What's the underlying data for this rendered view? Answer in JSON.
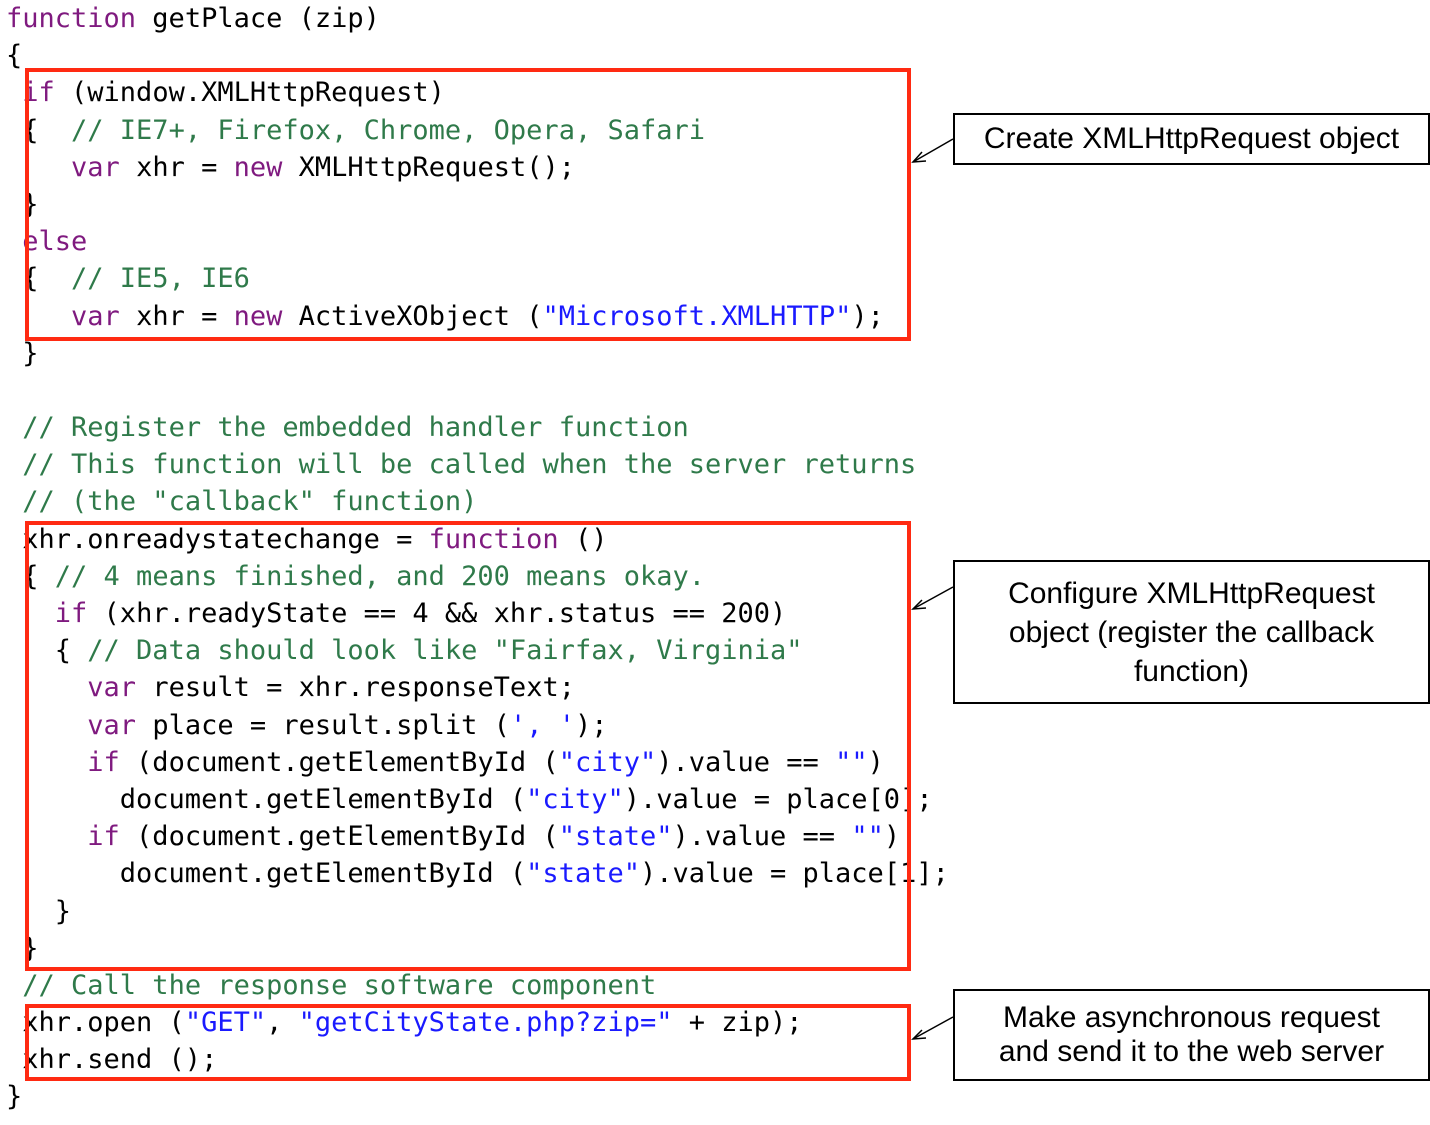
{
  "code_lines": [
    [
      {
        "t": "function",
        "c": "kw"
      },
      {
        "t": " getPlace (zip)",
        "c": "tx"
      }
    ],
    [
      {
        "t": "{",
        "c": "tx"
      }
    ],
    [
      {
        "t": " if",
        "c": "kw"
      },
      {
        "t": " (window.XMLHttpRequest)",
        "c": "tx"
      }
    ],
    [
      {
        "t": " {  ",
        "c": "tx"
      },
      {
        "t": "// IE7+, Firefox, Chrome, Opera, Safari",
        "c": "cm"
      }
    ],
    [
      {
        "t": "    ",
        "c": "tx"
      },
      {
        "t": "var",
        "c": "kw"
      },
      {
        "t": " xhr = ",
        "c": "tx"
      },
      {
        "t": "new",
        "c": "kw"
      },
      {
        "t": " XMLHttpRequest();",
        "c": "tx"
      }
    ],
    [
      {
        "t": " }",
        "c": "tx"
      }
    ],
    [
      {
        "t": " else",
        "c": "kw"
      }
    ],
    [
      {
        "t": " {  ",
        "c": "tx"
      },
      {
        "t": "// IE5, IE6",
        "c": "cm"
      }
    ],
    [
      {
        "t": "    ",
        "c": "tx"
      },
      {
        "t": "var",
        "c": "kw"
      },
      {
        "t": " xhr = ",
        "c": "tx"
      },
      {
        "t": "new",
        "c": "kw"
      },
      {
        "t": " ActiveXObject (",
        "c": "tx"
      },
      {
        "t": "\"Microsoft.XMLHTTP\"",
        "c": "st"
      },
      {
        "t": ");",
        "c": "tx"
      }
    ],
    [
      {
        "t": " }",
        "c": "tx"
      }
    ],
    [],
    [
      {
        "t": " ",
        "c": "tx"
      },
      {
        "t": "// Register the embedded handler function",
        "c": "cm"
      }
    ],
    [
      {
        "t": " ",
        "c": "tx"
      },
      {
        "t": "// This function will be called when the server returns",
        "c": "cm"
      }
    ],
    [
      {
        "t": " ",
        "c": "tx"
      },
      {
        "t": "// (the \"callback\" function)",
        "c": "cm"
      }
    ],
    [
      {
        "t": " xhr.onreadystatechange = ",
        "c": "tx"
      },
      {
        "t": "function",
        "c": "kw"
      },
      {
        "t": " ()",
        "c": "tx"
      }
    ],
    [
      {
        "t": " { ",
        "c": "tx"
      },
      {
        "t": "// 4 means finished, and 200 means okay.",
        "c": "cm"
      }
    ],
    [
      {
        "t": "   ",
        "c": "tx"
      },
      {
        "t": "if",
        "c": "kw"
      },
      {
        "t": " (xhr.readyState == 4 && xhr.status == 200)",
        "c": "tx"
      }
    ],
    [
      {
        "t": "   { ",
        "c": "tx"
      },
      {
        "t": "// Data should look like \"Fairfax, Virginia\"",
        "c": "cm"
      }
    ],
    [
      {
        "t": "     ",
        "c": "tx"
      },
      {
        "t": "var",
        "c": "kw"
      },
      {
        "t": " result = xhr.responseText;",
        "c": "tx"
      }
    ],
    [
      {
        "t": "     ",
        "c": "tx"
      },
      {
        "t": "var",
        "c": "kw"
      },
      {
        "t": " place = result.split (",
        "c": "tx"
      },
      {
        "t": "', '",
        "c": "st"
      },
      {
        "t": ");",
        "c": "tx"
      }
    ],
    [
      {
        "t": "     ",
        "c": "tx"
      },
      {
        "t": "if",
        "c": "kw"
      },
      {
        "t": " (document.getElementById (",
        "c": "tx"
      },
      {
        "t": "\"city\"",
        "c": "st"
      },
      {
        "t": ").value == ",
        "c": "tx"
      },
      {
        "t": "\"\"",
        "c": "st"
      },
      {
        "t": ")",
        "c": "tx"
      }
    ],
    [
      {
        "t": "       document.getElementById (",
        "c": "tx"
      },
      {
        "t": "\"city\"",
        "c": "st"
      },
      {
        "t": ").value = place[0];",
        "c": "tx"
      }
    ],
    [
      {
        "t": "     ",
        "c": "tx"
      },
      {
        "t": "if",
        "c": "kw"
      },
      {
        "t": " (document.getElementById (",
        "c": "tx"
      },
      {
        "t": "\"state\"",
        "c": "st"
      },
      {
        "t": ").value == ",
        "c": "tx"
      },
      {
        "t": "\"\"",
        "c": "st"
      },
      {
        "t": ")",
        "c": "tx"
      }
    ],
    [
      {
        "t": "       document.getElementById (",
        "c": "tx"
      },
      {
        "t": "\"state\"",
        "c": "st"
      },
      {
        "t": ").value = place[1];",
        "c": "tx"
      }
    ],
    [
      {
        "t": "   }",
        "c": "tx"
      }
    ],
    [
      {
        "t": " }",
        "c": "tx"
      }
    ],
    [
      {
        "t": " ",
        "c": "tx"
      },
      {
        "t": "// Call the response software component",
        "c": "cm"
      }
    ],
    [
      {
        "t": " xhr.open (",
        "c": "tx"
      },
      {
        "t": "\"GET\"",
        "c": "st"
      },
      {
        "t": ", ",
        "c": "tx"
      },
      {
        "t": "\"getCityState.php?zip=\"",
        "c": "st"
      },
      {
        "t": " + zip);",
        "c": "tx"
      }
    ],
    [
      {
        "t": " xhr.send ();",
        "c": "tx"
      }
    ],
    [
      {
        "t": "}",
        "c": "tx"
      }
    ]
  ],
  "callouts": {
    "create": "Create XMLHttpRequest object",
    "configure": "Configure XMLHttpRequest\nobject (register the callback\nfunction)",
    "send": "Make asynchronous request\nand send it to the web server"
  },
  "colors": {
    "keyword": "#7f1a7f",
    "comment": "#2f7a4a",
    "string": "#1a1aff",
    "highlight_border": "#ff2a12"
  }
}
